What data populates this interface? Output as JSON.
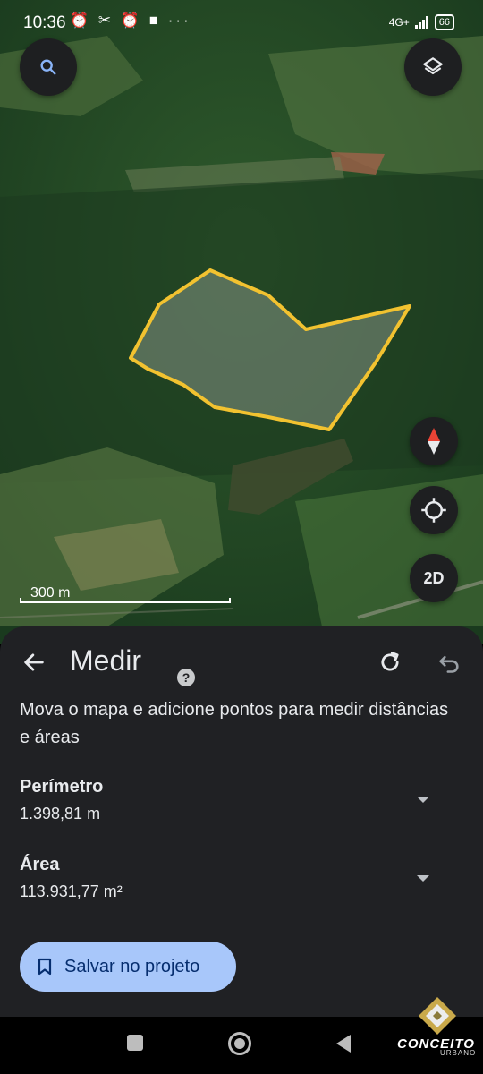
{
  "status_bar": {
    "time": "10:36",
    "notification_icons": "⏰ ✂ ⏰ ■ ···",
    "network": "4G+",
    "battery": "66"
  },
  "map": {
    "scale_label": "300 m",
    "mode_button": "2D",
    "outline_color": "#f2c230"
  },
  "sheet": {
    "title": "Medir",
    "description": "Mova o mapa e adicione pontos para medir distâncias e áreas",
    "perimeter_label": "Perímetro",
    "perimeter_value": "1.398,81 m",
    "area_label": "Área",
    "area_value": "113.931,77 m²",
    "save_button": "Salvar no projeto"
  },
  "watermark": {
    "name": "CONCEITO",
    "sub": "URBANO"
  },
  "colors": {
    "sheet_bg": "#202124",
    "button_bg": "#a8c7fa",
    "button_text": "#062e6f"
  }
}
